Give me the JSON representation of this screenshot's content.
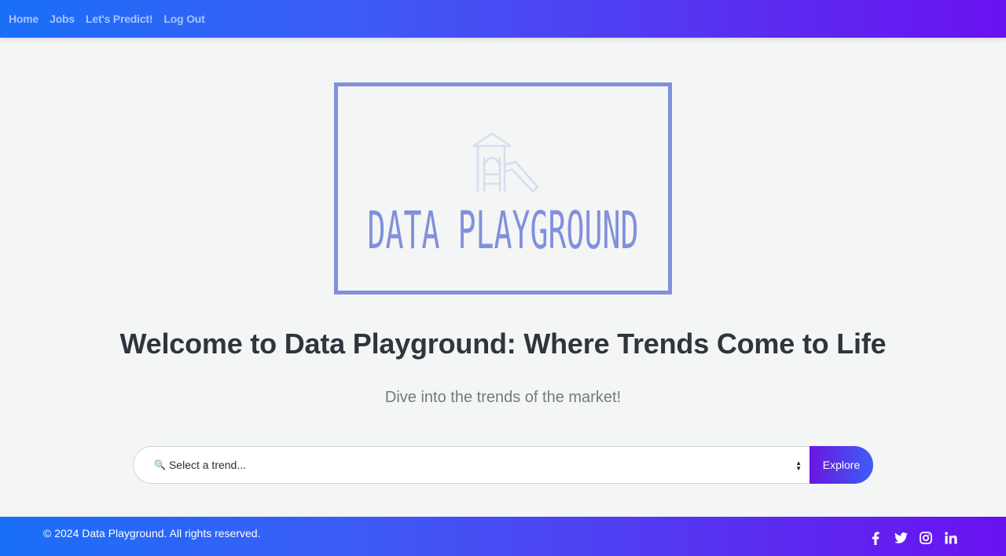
{
  "nav": {
    "home": "Home",
    "jobs": "Jobs",
    "predict": "Let's Predict!",
    "logout": "Log Out"
  },
  "logo": {
    "text": "DATA PLAYGROUND",
    "color": "#8190dc"
  },
  "hero": {
    "title": "Welcome to Data Playground: Where Trends Come to Life",
    "subtitle": "Dive into the trends of the market!"
  },
  "search": {
    "icon": "magnifier-icon",
    "selected": "Select a trend...",
    "button": "Explore"
  },
  "footer": {
    "copyright": "© 2024 Data Playground. All rights reserved.",
    "socials": [
      "facebook-icon",
      "twitter-icon",
      "instagram-icon",
      "linkedin-icon"
    ]
  },
  "colors": {
    "gradient_start": "#1a6ff7",
    "gradient_end": "#6a11f0",
    "background": "#f4f5f5"
  }
}
